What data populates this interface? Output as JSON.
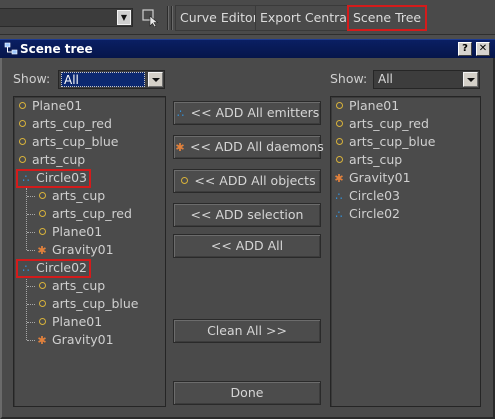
{
  "toolbar": {
    "buttons": [
      "Curve Editor",
      "Export Central",
      "Scene Tree"
    ]
  },
  "window": {
    "title": "Scene tree",
    "help_label": "?",
    "close_label": "✕"
  },
  "left": {
    "show_label": "Show:",
    "show_value": "All",
    "items": [
      {
        "label": "Plane01",
        "icon": "object"
      },
      {
        "label": "arts_cup_red",
        "icon": "object"
      },
      {
        "label": "arts_cup_blue",
        "icon": "object"
      },
      {
        "label": "arts_cup",
        "icon": "object"
      },
      {
        "label": "Circle03",
        "icon": "emitter",
        "highlighted": true
      },
      {
        "label": "arts_cup",
        "icon": "object",
        "child": true
      },
      {
        "label": "arts_cup_red",
        "icon": "object",
        "child": true
      },
      {
        "label": "Plane01",
        "icon": "object",
        "child": true
      },
      {
        "label": "Gravity01",
        "icon": "daemon",
        "child": true
      },
      {
        "label": "Circle02",
        "icon": "emitter",
        "highlighted": true
      },
      {
        "label": "arts_cup",
        "icon": "object",
        "child": true
      },
      {
        "label": "arts_cup_blue",
        "icon": "object",
        "child": true
      },
      {
        "label": "Plane01",
        "icon": "object",
        "child": true
      },
      {
        "label": "Gravity01",
        "icon": "daemon",
        "child": true
      }
    ]
  },
  "middle": {
    "add_emitters": "<< ADD All emitters",
    "add_daemons": "<< ADD All daemons",
    "add_objects": "<< ADD All objects",
    "add_selection": "<< ADD selection",
    "add_all": "<< ADD All",
    "clean_all": "Clean All >>",
    "done": "Done"
  },
  "right": {
    "show_label": "Show:",
    "show_value": "All",
    "items": [
      {
        "label": "Plane01",
        "icon": "object"
      },
      {
        "label": "arts_cup_red",
        "icon": "object"
      },
      {
        "label": "arts_cup_blue",
        "icon": "object"
      },
      {
        "label": "arts_cup",
        "icon": "object"
      },
      {
        "label": "Gravity01",
        "icon": "daemon"
      },
      {
        "label": "Circle03",
        "icon": "emitter"
      },
      {
        "label": "Circle02",
        "icon": "emitter"
      }
    ]
  },
  "colors": {
    "highlight": "#d41b1b",
    "titlebar": "#0a1f63",
    "object_icon": "#d8b23a",
    "emitter_icon": "#2e9cf0",
    "daemon_icon": "#e2813c"
  }
}
